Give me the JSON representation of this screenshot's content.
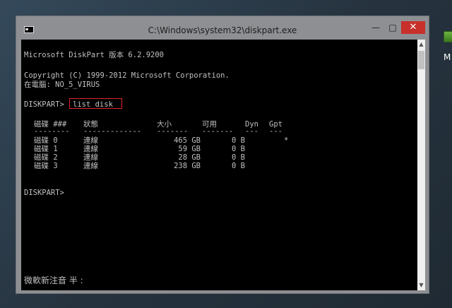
{
  "desktop": {
    "icon_label": "M"
  },
  "window": {
    "title": "C:\\Windows\\system32\\diskpart.exe",
    "minimize": "—",
    "maximize": "□",
    "close": "✕"
  },
  "console": {
    "line1": "Microsoft DiskPart 版本 6.2.9200",
    "line2": "Copyright (C) 1999-2012 Microsoft Corporation.",
    "line3": "在電腦: NO_5_VIRUS",
    "prompt": "DISKPART>",
    "command": "list disk",
    "table": {
      "headers": [
        "磁碟 ###",
        "狀態",
        "大小",
        "可用",
        "Dyn",
        "Gpt"
      ],
      "separators": [
        "--------",
        "-------------",
        "-------",
        "-------",
        "---",
        "---"
      ],
      "rows": [
        {
          "disk": "磁碟 0",
          "status": "連線",
          "size": "465 GB",
          "free": "0 B",
          "dyn": "",
          "gpt": "*"
        },
        {
          "disk": "磁碟 1",
          "status": "連線",
          "size": "59 GB",
          "free": "0 B",
          "dyn": "",
          "gpt": ""
        },
        {
          "disk": "磁碟 2",
          "status": "連線",
          "size": "28 GB",
          "free": "0 B",
          "dyn": "",
          "gpt": ""
        },
        {
          "disk": "磁碟 3",
          "status": "連線",
          "size": "238 GB",
          "free": "0 B",
          "dyn": "",
          "gpt": ""
        }
      ]
    },
    "prompt2": "DISKPART>",
    "ime_status": "微軟新注音 半 :"
  },
  "colors": {
    "console_bg": "#000000",
    "console_text": "#c0c0c0",
    "highlight": "#e0262a",
    "close_btn": "#c7302b"
  }
}
